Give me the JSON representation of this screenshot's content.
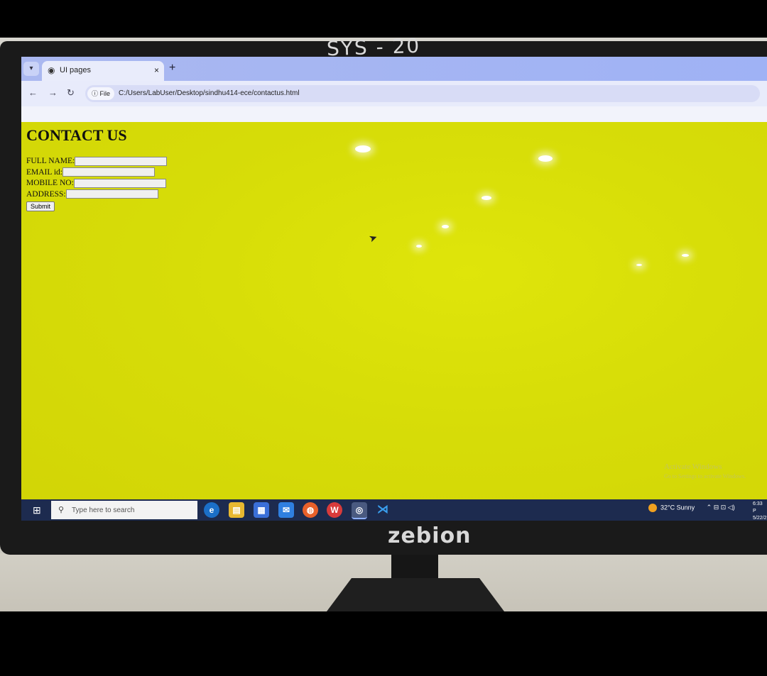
{
  "photo": {
    "monitor_label": "SYS - 20",
    "monitor_brand": "zebion"
  },
  "browser": {
    "tab_title": "UI pages",
    "new_tab_symbol": "+",
    "close_symbol": "×",
    "site_info": "ⓘ File",
    "url": "C:/Users/LabUser/Desktop/sindhu414-ece/contactus.html"
  },
  "page": {
    "heading": "CONTACT US",
    "fields": [
      {
        "label": "FULL NAME:"
      },
      {
        "label": "EMAIL id:"
      },
      {
        "label": "MOBILE NO:"
      },
      {
        "label": "ADDRESS:"
      }
    ],
    "submit_label": "Submit",
    "background_color": "#d4dc06",
    "watermark_line1": "Activate Windows",
    "watermark_line2": "Go to Settings to activate Windows."
  },
  "taskbar": {
    "search_placeholder": "Type here to search",
    "weather_temp": "32°C",
    "weather_text": "Sunny",
    "clock_time": "6:33 P",
    "clock_date": "5/22/2"
  }
}
